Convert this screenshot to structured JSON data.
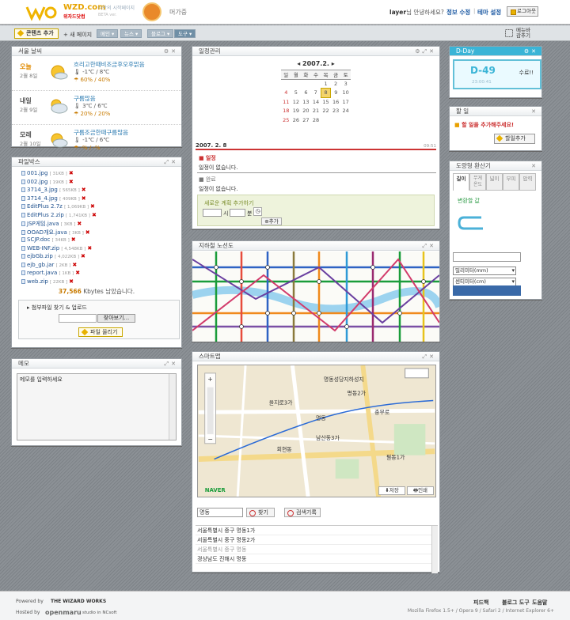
{
  "header": {
    "logo_text": "WZD.com",
    "logo_sub": "위자드닷컴",
    "slogan": "나만의 시작페이지",
    "slogan_sub": "BETA ver.",
    "username": "머가중",
    "greeting_user": "layer",
    "greeting_suffix": "님 안녕하세요?",
    "info_link": "정보 수정",
    "theme_link": "테마 설정",
    "logout": "로그아웃"
  },
  "toolbar": {
    "add_content": "콘텐츠 추가",
    "new_page": "+ 새 페이지",
    "tabs": [
      "메인 ▾",
      "뉴스 ▾",
      "블로그 ▾",
      "도구 ▾"
    ],
    "menu_hide_1": "메뉴바",
    "menu_hide_2": "감추기"
  },
  "weather": {
    "title": "서울 날씨",
    "rows": [
      {
        "day": "오늘",
        "date": "2월 8일",
        "desc": "흐리고한때비조금후오후맑음",
        "temp": "-1℃ / 8℃",
        "prob": "60% / 40%"
      },
      {
        "day": "내일",
        "date": "2월 9일",
        "desc": "구름많음",
        "temp": "3℃ / 6℃",
        "prob": "20% / 20%"
      },
      {
        "day": "모레",
        "date": "2월 10일",
        "desc": "구름조금한때구름많음",
        "temp": "-1℃ / 6℃",
        "prob": "-% / -%"
      }
    ]
  },
  "filebox": {
    "title": "파일박스",
    "files": [
      {
        "name": "001.jpg",
        "size": "[ 31KB ]"
      },
      {
        "name": "002.jpg",
        "size": "[ 19KB ]"
      },
      {
        "name": "3714_3.jpg",
        "size": "[ 565KB ]"
      },
      {
        "name": "3714_4.jpg",
        "size": "[ 409KB ]"
      },
      {
        "name": "EditPlus 2.7z",
        "size": "[ 1,069KB ]"
      },
      {
        "name": "EditPlus 2.zip",
        "size": "[ 1,741KB ]"
      },
      {
        "name": "JSP게임.java",
        "size": "[ 3KB ]"
      },
      {
        "name": "OOAD개요.java",
        "size": "[ 3KB ]"
      },
      {
        "name": "SCJP.doc",
        "size": "[ 34KB ]"
      },
      {
        "name": "WEB-INF.zip",
        "size": "[ 4,548KB ]"
      },
      {
        "name": "ejbGb.zip",
        "size": "[ 4,022KB ]"
      },
      {
        "name": "ejb_gb.jar",
        "size": "[ 2KB ]"
      },
      {
        "name": "report.java",
        "size": "[ 1KB ]"
      },
      {
        "name": "web.zip",
        "size": "[ 22KB ]"
      }
    ],
    "quota_num": "37,566",
    "quota_text": " Kbytes 남았습니다.",
    "upload_title": "첨부파일 찾기 & 업로드",
    "browse": "찾아보기...",
    "upload_btn": "파일 올리기"
  },
  "memo": {
    "title": "메모",
    "placeholder": "메모를 입력하세요"
  },
  "schedule": {
    "title": "일정관리",
    "month": "◂ 2007.2. ▸",
    "weekdays": [
      "일",
      "월",
      "화",
      "수",
      "목",
      "금",
      "토"
    ],
    "weeks": [
      [
        "",
        "",
        "",
        "",
        "1",
        "2",
        "3"
      ],
      [
        "4",
        "5",
        "6",
        "7",
        "8",
        "9",
        "10"
      ],
      [
        "11",
        "12",
        "13",
        "14",
        "15",
        "16",
        "17"
      ],
      [
        "18",
        "19",
        "20",
        "21",
        "22",
        "23",
        "24"
      ],
      [
        "25",
        "26",
        "27",
        "28",
        "",
        "",
        ""
      ]
    ],
    "today": "8",
    "selected_date": "2007. 2. 8",
    "time": "09:51",
    "sec1_title": "일정",
    "sec1_body": "일정이 없습니다.",
    "sec2_title": "완료",
    "sec2_body": "일정이 없습니다.",
    "add_label": "새로운 계획 추가하기",
    "hour_label": "시",
    "min_label": "분",
    "add_btn": "추가"
  },
  "subway": {
    "title": "지하철 노선도"
  },
  "smartmap": {
    "title": "스마트맵",
    "labels": [
      "명동성당지하성지",
      "명동2가",
      "명동",
      "을지로3가",
      "회현동",
      "남산동3가",
      "충무로",
      "필동1가"
    ],
    "save": "저장",
    "print": "인쇄",
    "search_value": "명동",
    "find": "찾기",
    "history": "검색기록",
    "results": [
      "서울특별시 중구 명동1가",
      "서울특별시 중구 명동2가",
      "서울특별시 중구 명동",
      "경상남도 진해시 명동"
    ]
  },
  "dday": {
    "title": "D-Day",
    "value": "D-49",
    "time": "23:00:41",
    "label": "수료!!"
  },
  "todo": {
    "title": "할 일",
    "text": "할 일을 추가해주세요!",
    "add": "할일추가"
  },
  "converter": {
    "title": "도량형 환산기",
    "tabs": [
      "길이",
      "무게",
      "온도",
      "넓이",
      "부피",
      "압력"
    ],
    "label": "변환할 값",
    "unit_from": "밀리미터(mm)",
    "unit_to": "센티미터(cm)"
  },
  "footer": {
    "powered": "Powered by",
    "brand": "THE WIZARD WORKS",
    "hosted": "Hosted by",
    "host": "openmaru",
    "studio": "studio in NCsoft",
    "links": [
      "피드백",
      "블로그 도구",
      "도움말"
    ],
    "compat": "Mozilla Firefox 1.5+ / Opera 9 / Safari 2 / Internet Explorer 6+"
  },
  "colors": {
    "accent": "#e8b200",
    "link": "#1d5aa3",
    "bg": "#858a8f",
    "dday": "#3ab4d6"
  }
}
